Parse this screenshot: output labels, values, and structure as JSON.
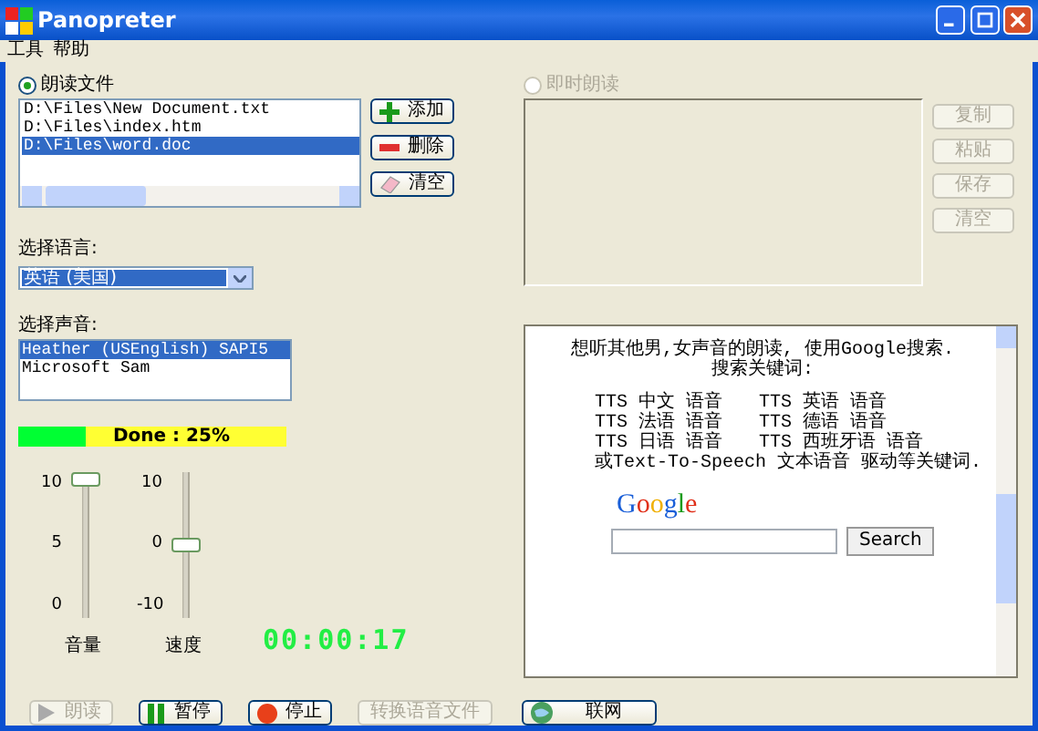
{
  "window": {
    "title": "Panopreter"
  },
  "menu": [
    "工具",
    "帮助"
  ],
  "file_reader": {
    "label": "朗读文件",
    "selected": true,
    "files": [
      {
        "path": "D:\\Files\\New Document.txt",
        "selected": false
      },
      {
        "path": "D:\\Files\\index.htm",
        "selected": false
      },
      {
        "path": "D:\\Files\\word.doc",
        "selected": true
      }
    ],
    "buttons": [
      {
        "label": "添加",
        "kind": "add"
      },
      {
        "label": "删除",
        "kind": "remove"
      },
      {
        "label": "清空",
        "kind": "erase"
      }
    ]
  },
  "language": {
    "label": "选择语言:",
    "value": "英语 (美国)"
  },
  "voice": {
    "label": "选择声音:",
    "voices": [
      {
        "name": "Heather (USEnglish) SAPI5",
        "selected": true
      },
      {
        "name": "Microsoft Sam",
        "selected": false
      }
    ]
  },
  "progress": {
    "text": "Done : 25%",
    "level": 0.25
  },
  "sliders": [
    {
      "label": "音量",
      "ticks": [
        "10",
        "5",
        "0"
      ],
      "level": 1
    },
    {
      "label": "速度",
      "ticks": [
        "10",
        "0",
        "-10"
      ],
      "level": 0.5
    }
  ],
  "timer": "00:00:17",
  "instant_reader": {
    "label": "即时朗读",
    "selected": false,
    "disabled": true,
    "buttons": [
      {
        "label": "复制",
        "disabled": true
      },
      {
        "label": "粘贴",
        "disabled": true
      },
      {
        "label": "保存",
        "disabled": true
      },
      {
        "label": "清空",
        "disabled": true
      }
    ]
  },
  "browser": {
    "intro": "想听其他男,女声音的朗读, 使用Google搜索.",
    "intro_2": "搜索关键词:",
    "terms": [
      "TTS 中文 语音",
      "TTS 英语 语音",
      "TTS 法语 语音",
      "TTS 德语 语音",
      "TTS 日语 语音",
      "TTS 西班牙语 语音"
    ],
    "note": "或Text-To-Speech 文本语音 驱动等关键词.",
    "logo": "Google",
    "search_button": "Search"
  },
  "actions": [
    {
      "label": "朗读",
      "kind": "play",
      "disabled": true
    },
    {
      "label": "暂停",
      "kind": "pause",
      "disabled": false
    },
    {
      "label": "停止",
      "kind": "stop",
      "disabled": false
    },
    {
      "label": "转换语音文件",
      "kind": "convert",
      "disabled": true
    },
    {
      "label": "联网",
      "kind": "web",
      "disabled": false
    }
  ]
}
